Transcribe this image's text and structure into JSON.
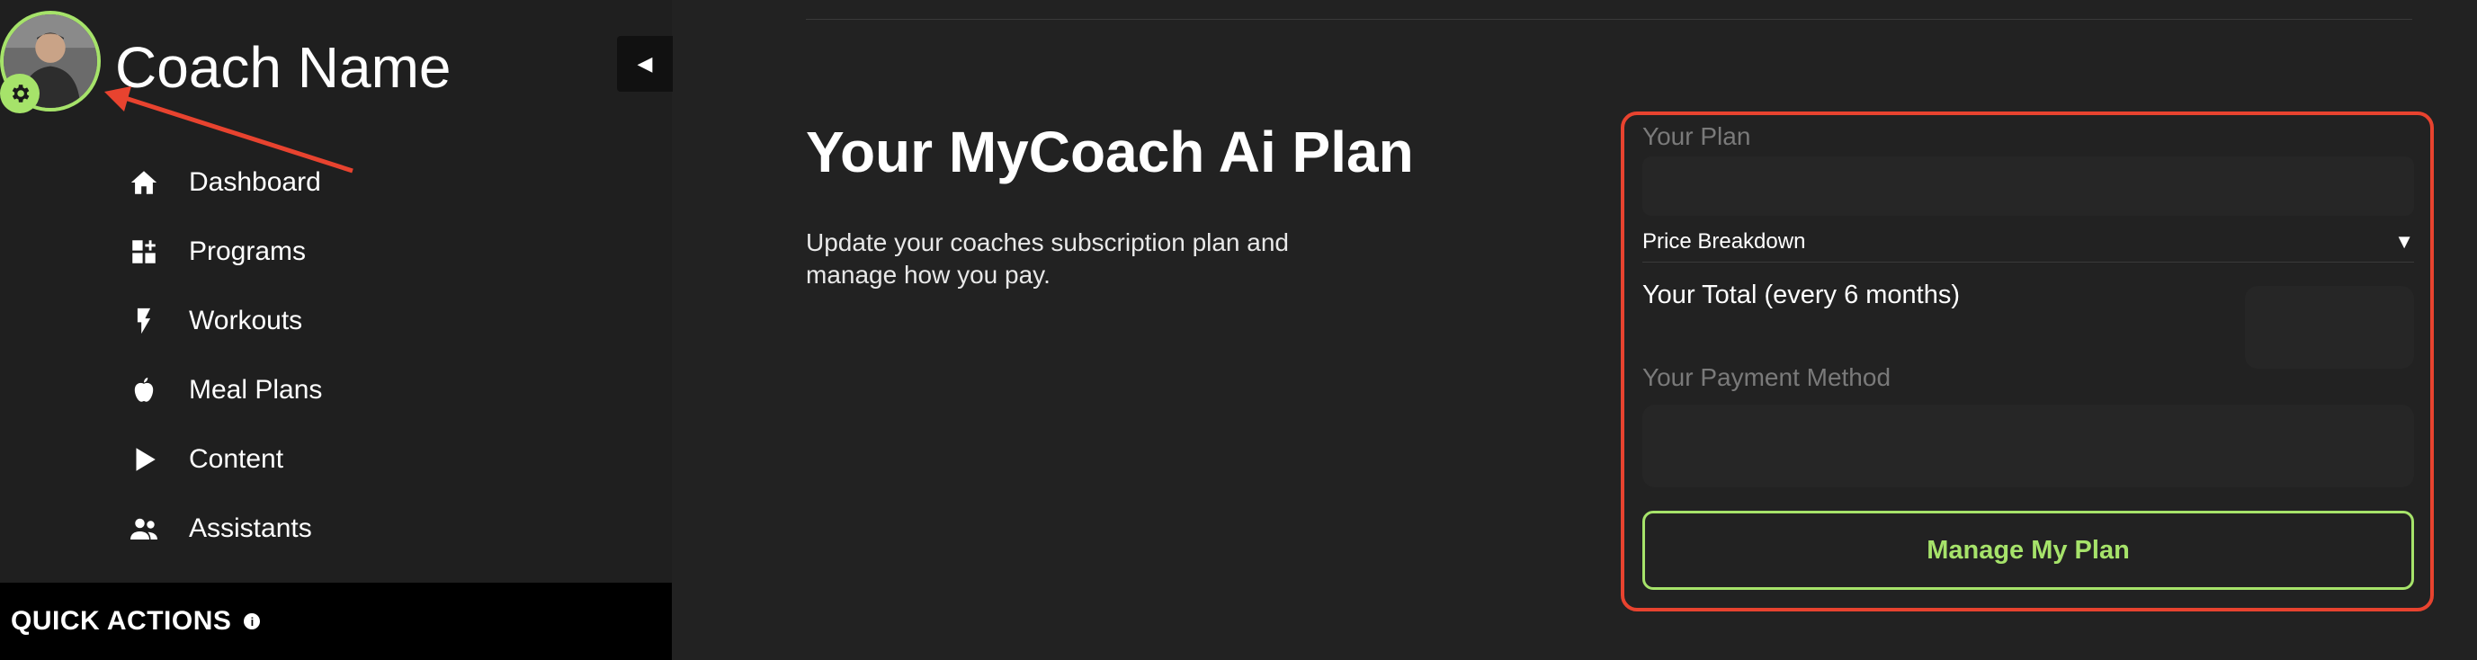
{
  "sidebar": {
    "coach_name": "Coach Name",
    "collapse_icon": "collapse-arrow-left-icon",
    "nav": [
      {
        "label": "Dashboard",
        "icon": "home-icon"
      },
      {
        "label": "Programs",
        "icon": "dashboard-grid-icon"
      },
      {
        "label": "Workouts",
        "icon": "lightning-bolt-icon"
      },
      {
        "label": "Meal Plans",
        "icon": "apple-icon"
      },
      {
        "label": "Content",
        "icon": "play-icon"
      },
      {
        "label": "Assistants",
        "icon": "people-icon"
      }
    ],
    "quick_actions": {
      "label": "QUICK ACTIONS",
      "info_glyph": "i"
    }
  },
  "main": {
    "title": "Your MyCoach Ai Plan",
    "description": "Update your coaches subscription plan and manage how you pay.",
    "plan_card": {
      "plan_label": "Your Plan",
      "price_breakdown_label": "Price Breakdown",
      "price_breakdown_arrow": "▼",
      "total_label": "Your Total (every 6 months)",
      "payment_label": "Your Payment Method",
      "manage_button": "Manage My Plan"
    }
  },
  "colors": {
    "accent_green": "#a6e36a",
    "highlight_red": "#e8432f",
    "background": "#222222",
    "sidebar_background": "#1f1f1f"
  }
}
